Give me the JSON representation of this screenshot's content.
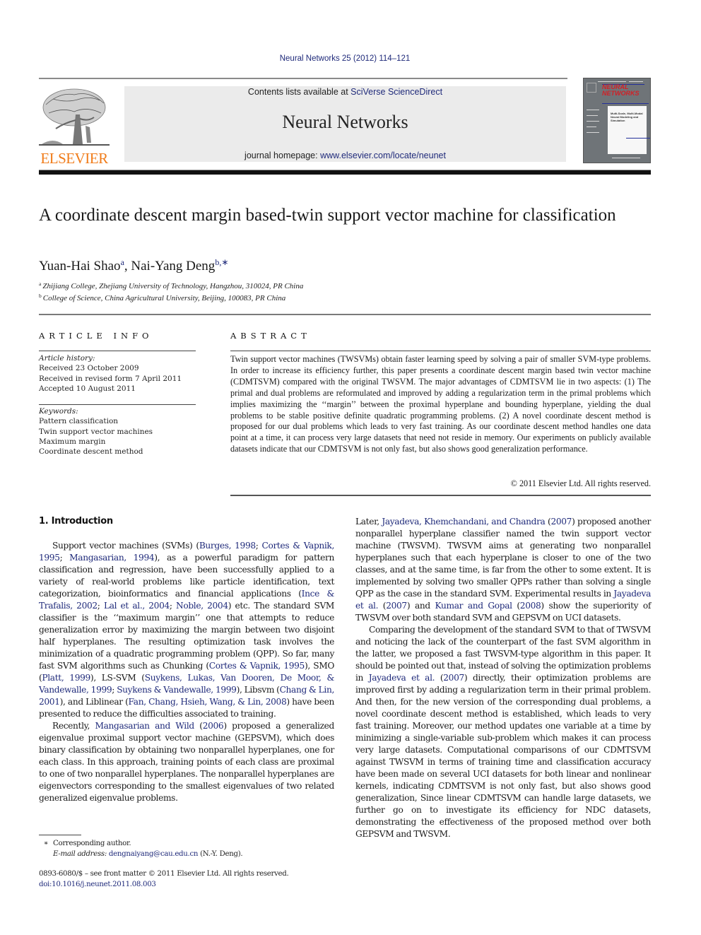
{
  "header": {
    "journal_ref": "Neural Networks 25 (2012) 114–121",
    "contents_prefix": "Contents lists available at ",
    "contents_link": "SciVerse ScienceDirect",
    "journal_name": "Neural Networks",
    "homepage_prefix": "journal homepage: ",
    "homepage_link": "www.elsevier.com/locate/neunet",
    "publisher_logo_text": "ELSEVIER",
    "cover": {
      "title_line1": "NEURAL",
      "title_line2": "NETWORKS",
      "panel_text": "Multi-Scale, Multi-Modal Neural Modeling and Simulation"
    },
    "colors": {
      "link": "#1f2a7a",
      "elsevier_orange": "#f07c1a",
      "header_box": "#ebebeb",
      "cover_red": "#d21f26"
    }
  },
  "article": {
    "title": "A coordinate descent margin based-twin support vector machine for classification",
    "authors": [
      {
        "name": "Yuan-Hai Shao",
        "sup": "a"
      },
      {
        "name": "Nai-Yang Deng",
        "sup": "b,∗"
      }
    ],
    "author_separator": ", ",
    "affiliations": [
      {
        "sup": "a",
        "text": "Zhijiang College, Zhejiang University of Technology, Hangzhou, 310024, PR China"
      },
      {
        "sup": "b",
        "text": "College of Science, China Agricultural University, Beijing, 100083, PR China"
      }
    ]
  },
  "article_info": {
    "heading": "ARTICLE INFO",
    "history_label": "Article history:",
    "history": [
      "Received 23 October 2009",
      "Received in revised form 7 April 2011",
      "Accepted 10 August 2011"
    ],
    "keywords_label": "Keywords:",
    "keywords": [
      "Pattern classification",
      "Twin support vector machines",
      "Maximum margin",
      "Coordinate descent method"
    ]
  },
  "abstract": {
    "heading": "ABSTRACT",
    "text": "Twin support vector machines (TWSVMs) obtain faster learning speed by solving a pair of smaller SVM-type problems. In order to increase its efficiency further, this paper presents a coordinate descent margin based twin vector machine (CDMTSVM) compared with the original TWSVM. The major advantages of CDMTSVM lie in two aspects: (1) The primal and dual problems are reformulated and improved by adding a regularization term in the primal problems which implies maximizing the ‘‘margin’’ between the proximal hyperplane and bounding hyperplane, yielding the dual problems to be stable positive definite quadratic programming problems. (2) A novel coordinate descent method is proposed for our dual problems which leads to very fast training. As our coordinate descent method handles one data point at a time, it can process very large datasets that need not reside in memory. Our experiments on publicly available datasets indicate that our CDMTSVM is not only fast, but also shows good generalization performance.",
    "copyright": "© 2011 Elsevier Ltd. All rights reserved."
  },
  "introduction": {
    "heading": "1.  Introduction",
    "p1": [
      {
        "t": "Support vector machines (SVMs) ("
      },
      {
        "l": "Burges, 1998"
      },
      {
        "t": "; "
      },
      {
        "l": "Cortes & Vapnik, 1995"
      },
      {
        "t": "; "
      },
      {
        "l": "Mangasarian, 1994"
      },
      {
        "t": "), as a powerful paradigm for pattern classification and regression, have been successfully applied to a variety of real-world problems like particle identification, text categorization, bioinformatics and financial applications ("
      },
      {
        "l": "Ince & Trafalis, 2002"
      },
      {
        "t": "; "
      },
      {
        "l": "Lal et al., 2004"
      },
      {
        "t": "; "
      },
      {
        "l": "Noble, 2004"
      },
      {
        "t": ") etc. The standard SVM classifier is the ‘‘maximum margin’’ one that attempts to reduce generalization error by maximizing the margin between two disjoint half hyperplanes. The resulting optimization task involves the minimization of a quadratic programming problem (QPP). So far, many fast SVM algorithms such as Chunking ("
      },
      {
        "l": "Cortes & Vapnik, 1995"
      },
      {
        "t": "), SMO ("
      },
      {
        "l": "Platt, 1999"
      },
      {
        "t": "), LS-SVM ("
      },
      {
        "l": "Suykens, Lukas, Van Dooren, De Moor, & Vandewalle, 1999"
      },
      {
        "t": "; "
      },
      {
        "l": "Suykens & Vandewalle, 1999"
      },
      {
        "t": "), Libsvm ("
      },
      {
        "l": "Chang & Lin, 2001"
      },
      {
        "t": "), and Liblinear ("
      },
      {
        "l": "Fan, Chang, Hsieh, Wang, & Lin, 2008"
      },
      {
        "t": ") have been presented to reduce the difficulties associated to training."
      }
    ],
    "p2": [
      {
        "t": "Recently, "
      },
      {
        "l": "Mangasarian and Wild"
      },
      {
        "t": " ("
      },
      {
        "l": "2006"
      },
      {
        "t": ") proposed a generalized eigenvalue proximal support vector machine (GEPSVM), which does binary classification by obtaining two nonparallel hyperplanes, one for each class. In this approach, training points of each class are proximal to one of two nonparallel hyperplanes. The nonparallel hyperplanes are eigenvectors corresponding to the smallest eigenvalues of two related generalized eigenvalue problems."
      }
    ],
    "p3": [
      {
        "t": "Later, "
      },
      {
        "l": "Jayadeva, Khemchandani, and Chandra"
      },
      {
        "t": " ("
      },
      {
        "l": "2007"
      },
      {
        "t": ") proposed another nonparallel hyperplane classifier named the twin support vector machine (TWSVM). TWSVM aims at generating two nonparallel hyperplanes such that each hyperplane is closer to one of the two classes, and at the same time, is far from the other to some extent. It is implemented by solving two smaller QPPs rather than solving a single QPP as the case in the standard SVM. Experimental results in "
      },
      {
        "l": "Jayadeva et al."
      },
      {
        "t": " ("
      },
      {
        "l": "2007"
      },
      {
        "t": ") and "
      },
      {
        "l": "Kumar and Gopal"
      },
      {
        "t": " ("
      },
      {
        "l": "2008"
      },
      {
        "t": ") show the superiority of TWSVM over both standard SVM and GEPSVM on UCI datasets."
      }
    ],
    "p4": [
      {
        "t": "Comparing the development of the standard SVM to that of TWSVM and noticing the lack of the counterpart of the fast SVM algorithm in the latter, we proposed a fast TWSVM-type algorithm in this paper. It should be pointed out that, instead of solving the optimization problems in "
      },
      {
        "l": "Jayadeva et al."
      },
      {
        "t": " ("
      },
      {
        "l": "2007"
      },
      {
        "t": ") directly, their optimization problems are improved first by adding a regularization term in their primal problem. And then, for the new version of the corresponding dual problems, a novel coordinate descent method is established, which leads to very fast training. Moreover, our method updates one variable at a time by minimizing a single-variable sub-problem which makes it can process very large datasets. Computational comparisons of our CDMTSVM against TWSVM in terms of training time and classification accuracy have been made on several UCI datasets for both linear and nonlinear kernels, indicating CDMTSVM is not only fast, but also shows good generalization, Since linear CDMTSVM can handle large datasets, we further go on to investigate its efficiency for NDC datasets, demonstrating the effectiveness of the proposed method over both GEPSVM and TWSVM."
      }
    ]
  },
  "footnote": {
    "symbol": "∗",
    "corresponding": "Corresponding author.",
    "email_label": "E-mail address:",
    "email": "dengnaiyang@cau.edu.cn",
    "email_suffix": " (N.-Y. Deng)."
  },
  "front_matter": {
    "issn_line": "0893-6080/$ – see front matter © 2011 Elsevier Ltd. All rights reserved.",
    "doi": "doi:10.1016/j.neunet.2011.08.003"
  }
}
